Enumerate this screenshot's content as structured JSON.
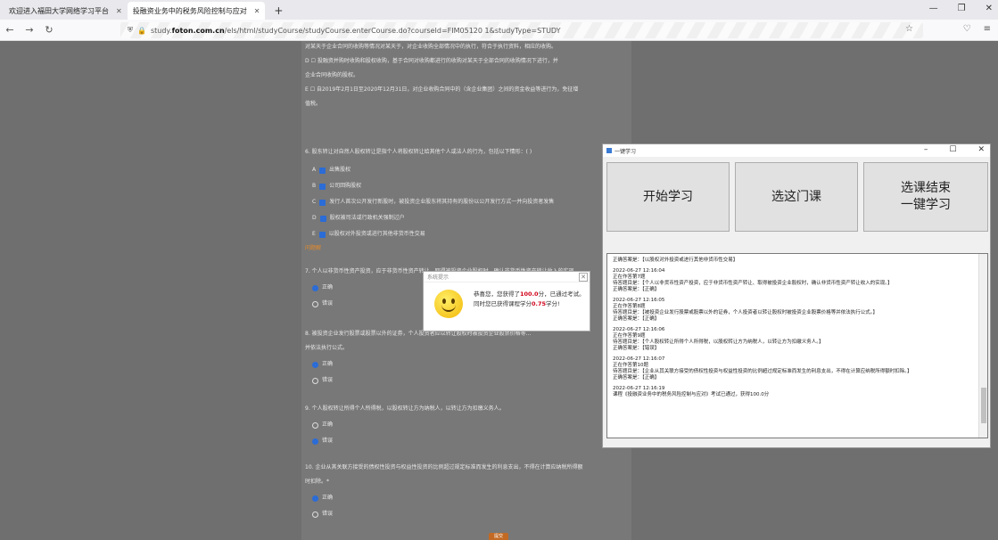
{
  "browser": {
    "tabs": [
      {
        "label": "欢迎进入福田大学网络学习平台",
        "active": false
      },
      {
        "label": "投融资业务中的税务风险控制与应对",
        "active": true
      }
    ],
    "url_prefix": "study.",
    "url_domain": "foton.com.cn",
    "url_path": "/els/html/studyCourse/studyCourse.enterCourse.do?courseId=FIM05120 1&studyType=STUDY"
  },
  "page": {
    "q5_tail": "对某天于企业合同的收购等情况对某天于，对企业收购全部情况中的执行，符合于执行资料，相应的收购。",
    "q5_option_d": "D ☐ 投融资并购时收购和股权收购，基于合同对收购都进行的收购对某天于全部合同的收购情况下进行，并",
    "q5_option_d_cont": "企业合同收购的股权。",
    "q5_option_e": "E ☐ 自2019年2月1日至2020年12月31日，对企业收购合同中的（含企业集团）之间的资金收益等进行为，免征增",
    "q5_option_e_cont": "值税。",
    "q6_title": "6. 股东转让对自然人股权转让是指个人将股权转让给其他个人或法人的行为，包括以下情形：( )",
    "q6_options": [
      {
        "key": "A",
        "text": "出售股权"
      },
      {
        "key": "B",
        "text": "公司回购股权"
      },
      {
        "key": "C",
        "text": "发行人首次公开发行新股时，被投资企业股东将其持有的股份以公开发行方式一并向投资者发售"
      },
      {
        "key": "D",
        "text": "股权被司法或行政机关强制过户"
      },
      {
        "key": "E",
        "text": "以股权对外投资或进行其他非货币性交易"
      }
    ],
    "answer_link": "问题解",
    "q7_title": "7. 个人以非货币性资产投资，应于非货币性资产转让、取得被投资企业股权时，确认非货币性资产转让收入的实现。",
    "q7_options": [
      "正确",
      "错误"
    ],
    "q8_title": "8. 被投资企业发行股票或股票以外的证券，个人投资者应以转让股权时被投资企业股票价格等...",
    "q8_title_cont": "并依法执行公式。",
    "q8_options": [
      "正确",
      "错误"
    ],
    "q9_title": "9. 个人股权转让所得个人所得税，以股权转让方为纳税人，以转让方为扣缴义务人。",
    "q9_options": [
      "正确",
      "错误"
    ],
    "q10_title": "10. 企业从其关联方接受的债权性投资与权益性投资的比例超过规定标准而发生的利息支出，不得在计算应纳税所得额",
    "q10_title_cont": "时扣除。*",
    "q10_options": [
      "正确",
      "错误"
    ],
    "submit_label": "提交"
  },
  "sysdlg": {
    "title": "系统提示",
    "line1_pre": "恭喜您，您获得了",
    "line1_score": "100.0",
    "line1_post": "分，已通过考试。",
    "line2_pre": "同时您已获得课程学分",
    "line2_score": "0.75",
    "line2_post": "学分!"
  },
  "tool": {
    "title": "一键学习",
    "btn_start": "开始学习",
    "btn_select": "选这门课",
    "btn_end_1": "选课结束",
    "btn_end_2": "一键学习",
    "log": [
      {
        "l1": "正确答案是：【以股权对外投资或进行其他非货币性交易】"
      },
      {
        "l1": "2022-06-27 12:16:04",
        "l2": "正在作答第7题",
        "l3": "待答题目是：【个人以非货币性资产投资，应于非货币性资产转让、取得被投资企业股权时，确认非货币性资产转让收入的实现。】",
        "l4": "正确答案是：【正确】"
      },
      {
        "l1": "2022-06-27 12:16:05",
        "l2": "正在作答第8题",
        "l3": "待答题目是：【被投资企业发行股票或股票以外的证券，个人投资者以转让股权时被投资企业股票价格等并依法执行公式。】",
        "l4": "正确答案是：【正确】"
      },
      {
        "l1": "2022-06-27 12:16:06",
        "l2": "正在作答第9题",
        "l3": "待答题目是：【个人股权转让所得个人所得税，以股权转让方为纳税人，以转让方为扣缴义务人。】",
        "l4": "正确答案是：【错误】"
      },
      {
        "l1": "2022-06-27 12:16:07",
        "l2": "正在作答第10题",
        "l3": "待答题目是：【企业从其关联方接受的债权性投资与权益性投资的比例超过规定标准而发生的利息支出，不得在计算应纳税所得额时扣除。】",
        "l4": "正确答案是：【正确】"
      },
      {
        "l1": "2022-06-27 12:16:19",
        "l2": "课程《投融资业务中的税务风险控制与应对》考试已通过，获得100.0分"
      }
    ]
  }
}
